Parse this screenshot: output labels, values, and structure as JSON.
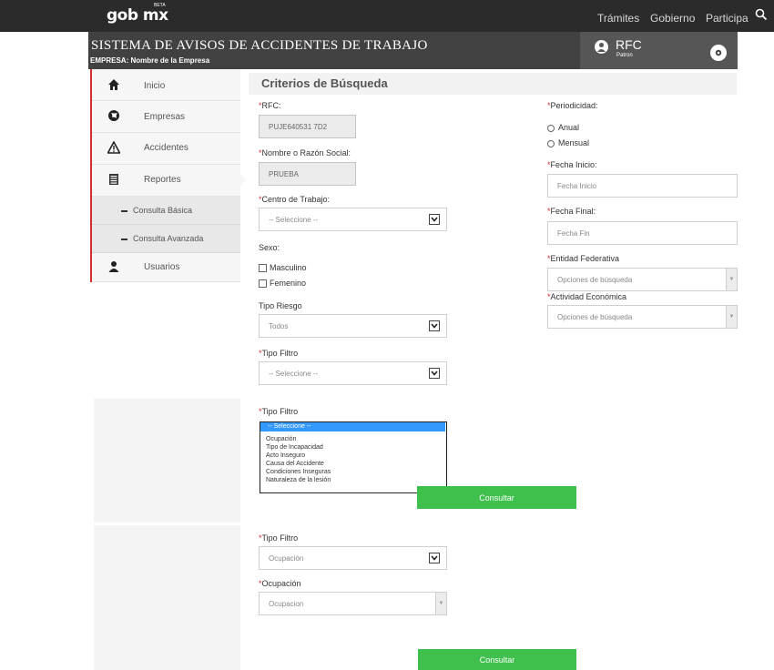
{
  "topnav": {
    "logo": "gob mx",
    "logo_badge": "BETA",
    "links": [
      "Trámites",
      "Gobierno",
      "Participa"
    ]
  },
  "system": {
    "title": "SISTEMA DE AVISOS DE ACCIDENTES DE TRABAJO",
    "empresa_label": "EMPRESA: Nombre de la Empresa"
  },
  "user": {
    "rfc_label": "RFC",
    "role": "Patron"
  },
  "sidebar": {
    "items": [
      {
        "label": "Inicio",
        "icon": "home-icon"
      },
      {
        "label": "Empresas",
        "icon": "globe-icon"
      },
      {
        "label": "Accidentes",
        "icon": "warning-icon"
      },
      {
        "label": "Reportes",
        "icon": "report-icon"
      }
    ],
    "sub_items": [
      "Consulta Básica",
      "Consulta Avanzada"
    ],
    "usuarios": "Usuarios"
  },
  "form": {
    "section_title": "Criterios de Búsqueda",
    "rfc_label": "RFC:",
    "rfc_value": "PUJE640531 7D2",
    "nombre_label": "Nombre o Razón Social:",
    "nombre_value": "PRUEBA",
    "centro_label": "Centro de Trabajo:",
    "centro_value": "-- Seleccione --",
    "sexo_label": "Sexo:",
    "sexo_options": [
      "Masculino",
      "Femenino"
    ],
    "tipo_riesgo_label": "Tipo Riesgo",
    "tipo_riesgo_value": "Todos",
    "tipo_filtro_label": "Tipo Filtro",
    "tipo_filtro_value": "-- Seleccione --",
    "periodicidad_label": "Periodicidad:",
    "periodicidad_options": [
      "Anual",
      "Mensual"
    ],
    "fecha_inicio_label": "Fecha Inicio:",
    "fecha_inicio_placeholder": "Fecha Inicio",
    "fecha_final_label": "Fecha Final:",
    "fecha_final_placeholder": "Fecha Fin",
    "entidad_label": "Entidad Federativa",
    "entidad_placeholder": "Opciones de búsqueda",
    "actividad_label": "Actividad Económica",
    "actividad_placeholder": "Opciones de búsqueda"
  },
  "dropdown_panel": {
    "label": "Tipo Filtro",
    "options": [
      "-- Seleccione --",
      "Ocupación",
      "Tipo de Incapacidad",
      "Acto Inseguro",
      "Causa del Accidente",
      "Condiciones Inseguras",
      "Naturaleza de la lesión"
    ],
    "button": "Consultar"
  },
  "panel3": {
    "tipo_filtro_label": "Tipo Filtro",
    "tipo_filtro_value": "Ocupación",
    "ocupacion_label": "Ocupación",
    "ocupacion_placeholder": "Ocupacion",
    "button": "Consultar"
  },
  "colors": {
    "accent_red": "#d32f2f",
    "button_green": "#3fbf4b",
    "header_dark": "#2b2b2b"
  }
}
